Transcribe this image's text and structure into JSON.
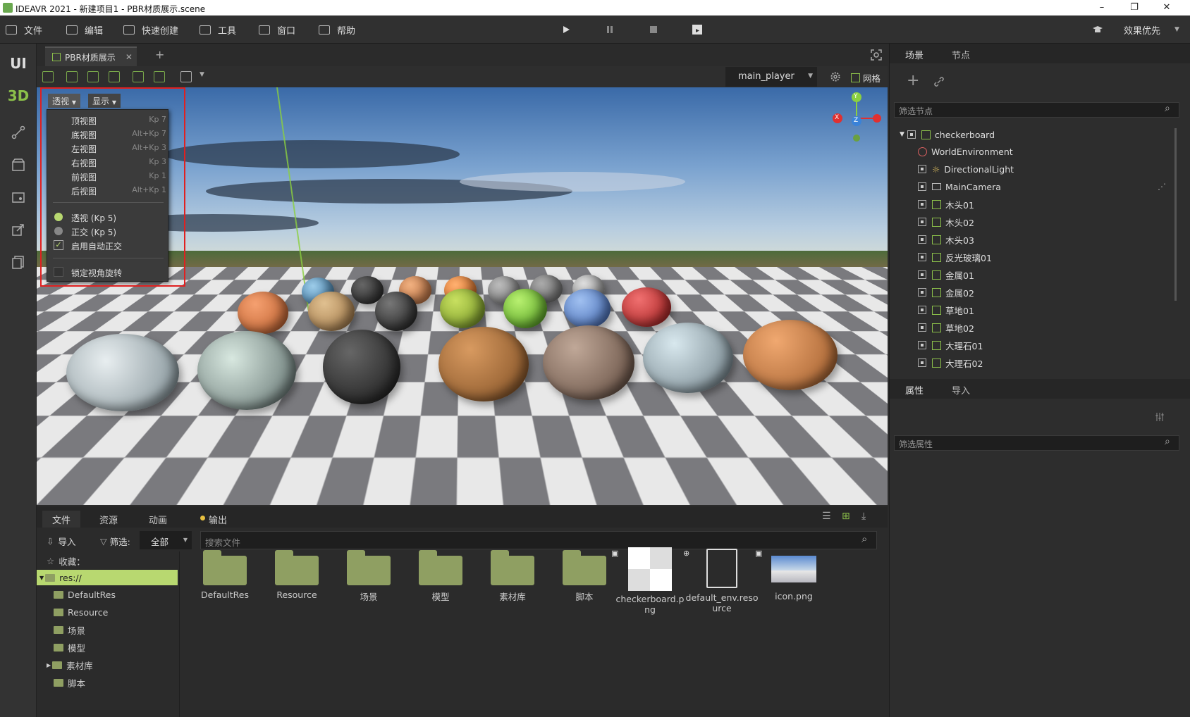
{
  "window": {
    "title": "IDEAVR 2021 - 新建项目1 - PBR材质展示.scene",
    "min": "–",
    "max": "❐",
    "close": "✕"
  },
  "menubar": {
    "items": [
      "文件",
      "编辑",
      "快速创建",
      "工具",
      "窗口",
      "帮助"
    ],
    "quality": "效果优先"
  },
  "leftstrip": {
    "ui": "UI",
    "d3": "3D"
  },
  "viewport": {
    "doc_tab": "PBR材质展示",
    "camera": "main_player",
    "grid": "网格",
    "view_btn": "透视",
    "display_btn": "显示",
    "gizmo": {
      "x": "X",
      "y": "Y",
      "z": "Z"
    }
  },
  "view_menu": {
    "items": [
      {
        "label": "顶视图",
        "key": "Kp 7"
      },
      {
        "label": "底视图",
        "key": "Alt+Kp 7"
      },
      {
        "label": "左视图",
        "key": "Alt+Kp 3"
      },
      {
        "label": "右视图",
        "key": "Kp 3"
      },
      {
        "label": "前视图",
        "key": "Kp 1"
      },
      {
        "label": "后视图",
        "key": "Alt+Kp 1"
      }
    ],
    "persp": "透视 (Kp 5)",
    "ortho": "正交 (Kp 5)",
    "auto_ortho": "启用自动正交",
    "lock_rotation": "锁定视角旋转"
  },
  "scene_panel": {
    "tabs": [
      "场景",
      "节点"
    ],
    "filter_placeholder": "筛选节点",
    "nodes": [
      "checkerboard",
      "WorldEnvironment",
      "DirectionalLight",
      "MainCamera",
      "木头01",
      "木头02",
      "木头03",
      "反光玻璃01",
      "金属01",
      "金属02",
      "草地01",
      "草地02",
      "大理石01",
      "大理石02"
    ]
  },
  "prop_panel": {
    "tabs": [
      "属性",
      "导入"
    ],
    "filter_placeholder": "筛选属性"
  },
  "bottom": {
    "tabs": [
      "文件",
      "资源",
      "动画",
      "输出"
    ],
    "import": "导入",
    "filter_label": "筛选:",
    "filter_value": "全部",
    "search_placeholder": "搜索文件",
    "favorites": "收藏：",
    "tree": [
      "res://",
      "DefaultRes",
      "Resource",
      "场景",
      "模型",
      "素材库",
      "脚本"
    ],
    "files": [
      {
        "name": "DefaultRes",
        "kind": "folder"
      },
      {
        "name": "Resource",
        "kind": "folder"
      },
      {
        "name": "场景",
        "kind": "folder"
      },
      {
        "name": "模型",
        "kind": "folder"
      },
      {
        "name": "素材库",
        "kind": "folder"
      },
      {
        "name": "脚本",
        "kind": "folder"
      },
      {
        "name": "checkerboard.png",
        "kind": "image"
      },
      {
        "name": "default_env.resource",
        "kind": "doc"
      },
      {
        "name": "icon.png",
        "kind": "image"
      }
    ]
  }
}
